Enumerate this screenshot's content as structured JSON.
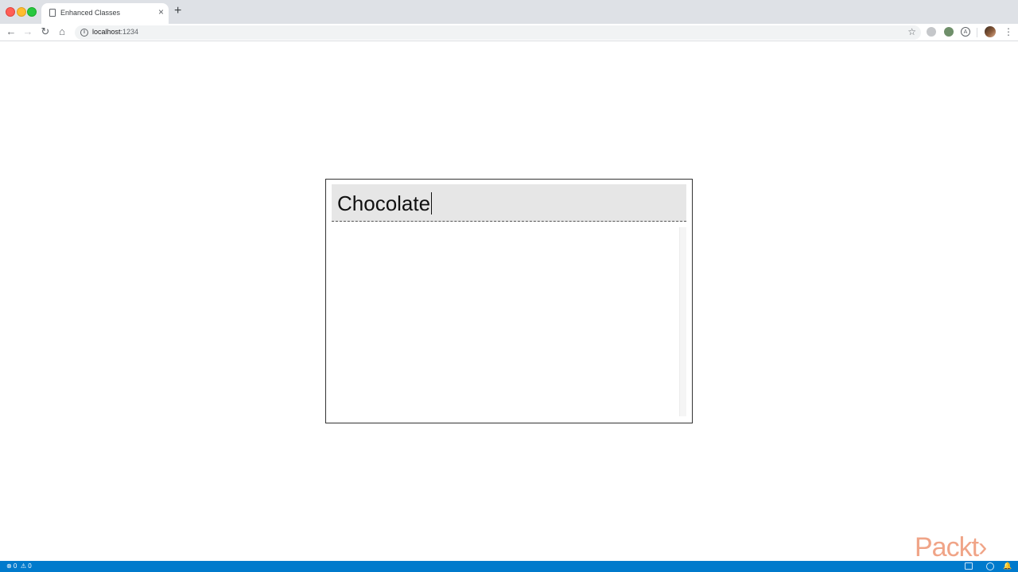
{
  "browser": {
    "tab_title": "Enhanced Classes",
    "tab_close": "×",
    "new_tab": "+",
    "url_host": "localhost",
    "url_port": ":1234"
  },
  "toolbar": {
    "back": "←",
    "forward": "→",
    "reload": "↻",
    "home": "⌂",
    "star": "☆",
    "menu": "⋮"
  },
  "editor": {
    "value": "Chocolate"
  },
  "watermark": {
    "logo_text": "Packt›"
  },
  "statusbar": {
    "errors": "⊗ 0",
    "warnings": "⚠ 0",
    "bell": "🔔"
  },
  "colors": {
    "statusbar_bg": "#007acc",
    "input_bg": "#e6e6e6",
    "logo": "#f0a487"
  }
}
